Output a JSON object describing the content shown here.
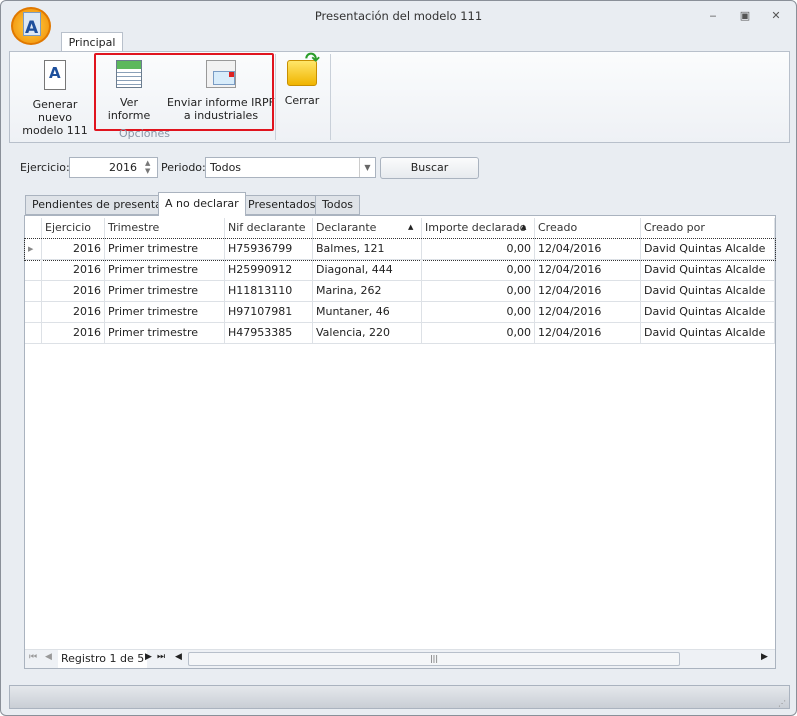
{
  "window": {
    "title": "Presentación del modelo 111",
    "minimize": "‒",
    "maximize": "▣",
    "close": "✕"
  },
  "ribbon": {
    "tab": "Principal",
    "group_label": "Opciones",
    "buttons": {
      "generar": "Generar nuevo modelo 111",
      "ver": "Ver informe",
      "enviar": "Enviar informe IRPF a industriales",
      "cerrar": "Cerrar"
    }
  },
  "filters": {
    "ejercicio_label": "Ejercicio:",
    "ejercicio_value": "2016",
    "periodo_label": "Periodo:",
    "periodo_value": "Todos",
    "buscar": "Buscar"
  },
  "tabs": [
    "Pendientes de presentar",
    "A no declarar",
    "Presentados",
    "Todos"
  ],
  "grid": {
    "columns": [
      "Ejercicio",
      "Trimestre",
      "Nif declarante",
      "Declarante",
      "Importe declarado",
      "Creado",
      "Creado por"
    ],
    "rows": [
      [
        "2016",
        "Primer trimestre",
        "H75936799",
        "Balmes, 121",
        "0,00",
        "12/04/2016",
        "David Quintas Alcalde"
      ],
      [
        "2016",
        "Primer trimestre",
        "H25990912",
        "Diagonal, 444",
        "0,00",
        "12/04/2016",
        "David Quintas Alcalde"
      ],
      [
        "2016",
        "Primer trimestre",
        "H11813110",
        "Marina, 262",
        "0,00",
        "12/04/2016",
        "David Quintas Alcalde"
      ],
      [
        "2016",
        "Primer trimestre",
        "H97107981",
        "Muntaner, 46",
        "0,00",
        "12/04/2016",
        "David Quintas Alcalde"
      ],
      [
        "2016",
        "Primer trimestre",
        "H47953385",
        "Valencia, 220",
        "0,00",
        "12/04/2016",
        "David Quintas Alcalde"
      ]
    ]
  },
  "navigator": {
    "record": "Registro 1 de 5"
  }
}
